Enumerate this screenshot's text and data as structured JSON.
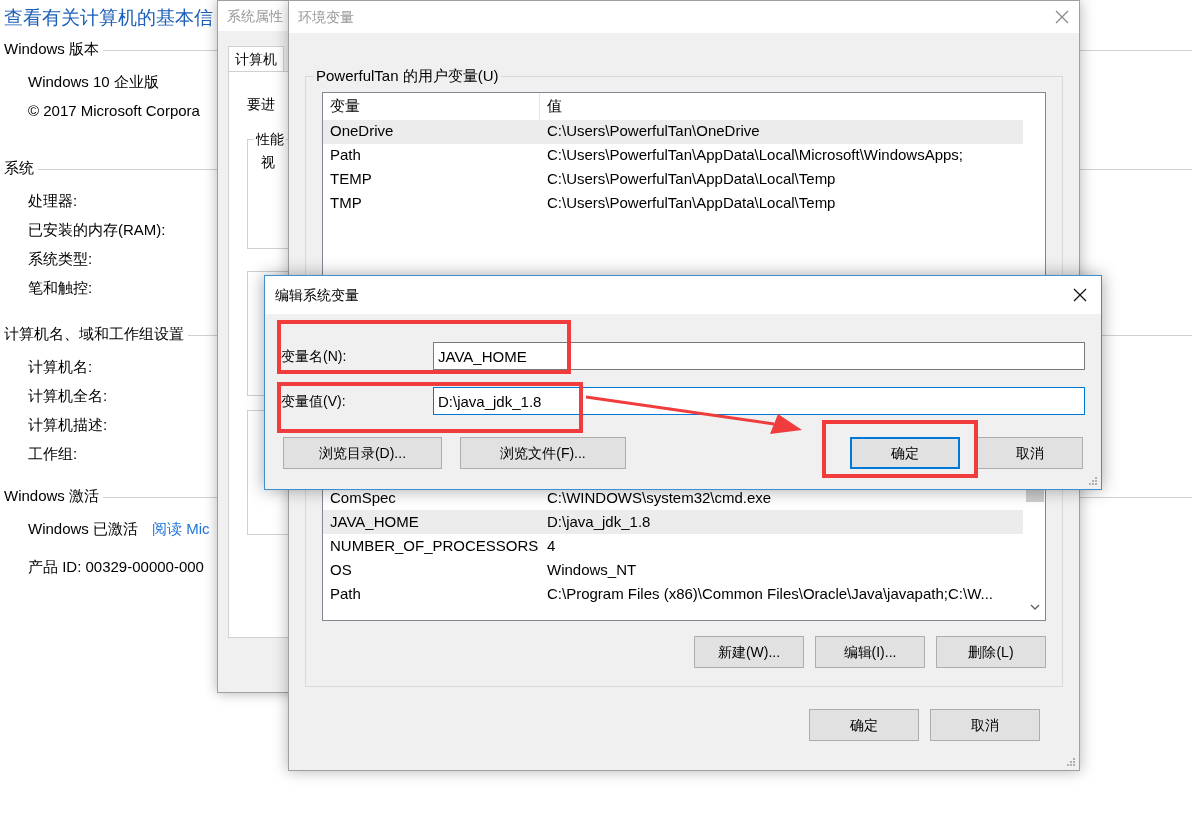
{
  "info_page": {
    "title": "查看有关计算机的基本信",
    "sections": [
      {
        "heading": "Windows 版本",
        "items": [
          {
            "label": "Windows 10 企业版"
          },
          {
            "label": "© 2017 Microsoft Corpora"
          }
        ]
      },
      {
        "heading": "系统",
        "items": [
          {
            "label": "处理器:"
          },
          {
            "label": "已安装的内存(RAM):"
          },
          {
            "label": "系统类型:"
          },
          {
            "label": "笔和触控:"
          }
        ]
      },
      {
        "heading": "计算机名、域和工作组设置",
        "items": [
          {
            "label": "计算机名:"
          },
          {
            "label": "计算机全名:"
          },
          {
            "label": "计算机描述:"
          },
          {
            "label": "工作组:"
          }
        ]
      },
      {
        "heading": "Windows 激活",
        "items": [
          {
            "label": "Windows 已激活",
            "link": "阅读 Mic"
          },
          {
            "label": "产品 ID: 00329-00000-000"
          }
        ]
      }
    ]
  },
  "system_properties": {
    "title": "系统属性",
    "tab": "计算机",
    "intro": "要进",
    "groups": [
      {
        "legend": "性能",
        "text": "视"
      }
    ]
  },
  "environment_window": {
    "title": "环境变量",
    "user_variables": {
      "legend": "PowerfulTan 的用户变量(U)",
      "columns": [
        "变量",
        "值"
      ],
      "rows": [
        {
          "name": "OneDrive",
          "value": "C:\\Users\\PowerfulTan\\OneDrive",
          "selected": true
        },
        {
          "name": "Path",
          "value": "C:\\Users\\PowerfulTan\\AppData\\Local\\Microsoft\\WindowsApps;",
          "selected": false
        },
        {
          "name": "TEMP",
          "value": "C:\\Users\\PowerfulTan\\AppData\\Local\\Temp",
          "selected": false
        },
        {
          "name": "TMP",
          "value": "C:\\Users\\PowerfulTan\\AppData\\Local\\Temp",
          "selected": false
        }
      ]
    },
    "system_variables": {
      "rows": [
        {
          "name": "ComSpec",
          "value": "C:\\WINDOWS\\system32\\cmd.exe",
          "selected": false
        },
        {
          "name": "JAVA_HOME",
          "value": "D:\\java_jdk_1.8",
          "selected": true
        },
        {
          "name": "NUMBER_OF_PROCESSORS",
          "value": "4",
          "selected": false
        },
        {
          "name": "OS",
          "value": "Windows_NT",
          "selected": false
        },
        {
          "name": "Path",
          "value": "C:\\Program Files (x86)\\Common Files\\Oracle\\Java\\javapath;C:\\W...",
          "selected": false
        }
      ],
      "buttons": [
        "新建(W)...",
        "编辑(I)...",
        "删除(L)"
      ]
    },
    "buttons": [
      "确定",
      "取消"
    ]
  },
  "edit_dialog": {
    "title": "编辑系统变量",
    "fields": [
      {
        "label": "变量名(N):",
        "value": "JAVA_HOME",
        "focused": false
      },
      {
        "label": "变量值(V):",
        "value": "D:\\java_jdk_1.8",
        "focused": true
      }
    ],
    "buttons": [
      {
        "label": "浏览目录(D)...",
        "focused": false
      },
      {
        "label": "浏览文件(F)...",
        "focused": false
      },
      {
        "label": "确定",
        "focused": true
      },
      {
        "label": "取消",
        "focused": false
      }
    ]
  }
}
